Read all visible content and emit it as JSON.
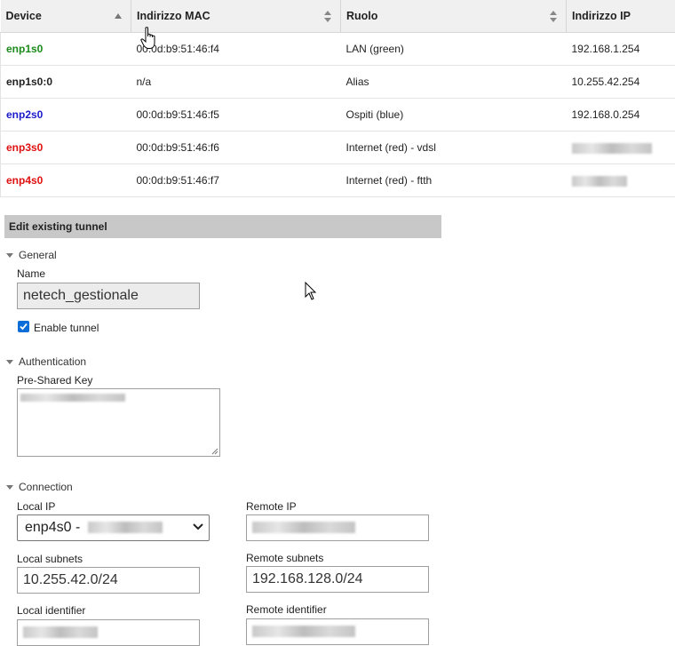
{
  "table": {
    "headers": [
      "Device",
      "Indirizzo MAC",
      "Ruolo",
      "Indirizzo IP"
    ],
    "rows": [
      {
        "device": "enp1s0",
        "device_color": "#1a8a1a",
        "mac": "00:0d:b9:51:46:f4",
        "role": "LAN (green)",
        "ip": "192.168.1.254"
      },
      {
        "device": "enp1s0:0",
        "device_color": "#222222",
        "mac": "n/a",
        "role": "Alias",
        "ip": "10.255.42.254"
      },
      {
        "device": "enp2s0",
        "device_color": "#1a1acc",
        "mac": "00:0d:b9:51:46:f5",
        "role": "Ospiti (blue)",
        "ip": "192.168.0.254"
      },
      {
        "device": "enp3s0",
        "device_color": "#e01010",
        "mac": "00:0d:b9:51:46:f6",
        "role": "Internet (red) - vdsl",
        "ip": ""
      },
      {
        "device": "enp4s0",
        "device_color": "#e01010",
        "mac": "00:0d:b9:51:46:f7",
        "role": "Internet (red) - ftth",
        "ip": ""
      }
    ]
  },
  "editor": {
    "title": "Edit existing tunnel",
    "general": {
      "title": "General",
      "name_label": "Name",
      "name_value": "netech_gestionale",
      "enable_label": "Enable tunnel",
      "enabled": true
    },
    "auth": {
      "title": "Authentication",
      "psk_label": "Pre-Shared Key"
    },
    "connection": {
      "title": "Connection",
      "local_ip_label": "Local IP",
      "local_ip_value": "enp4s0 -",
      "remote_ip_label": "Remote IP",
      "local_subnets_label": "Local subnets",
      "local_subnets_value": "10.255.42.0/24",
      "remote_subnets_label": "Remote subnets",
      "remote_subnets_value": "192.168.128.0/24",
      "local_identifier_label": "Local identifier",
      "remote_identifier_label": "Remote identifier"
    }
  },
  "colors": {
    "section_bg": "#c8c8c8",
    "checkbox": "#0b6ed8",
    "header_bg": "#f0f0f0"
  }
}
